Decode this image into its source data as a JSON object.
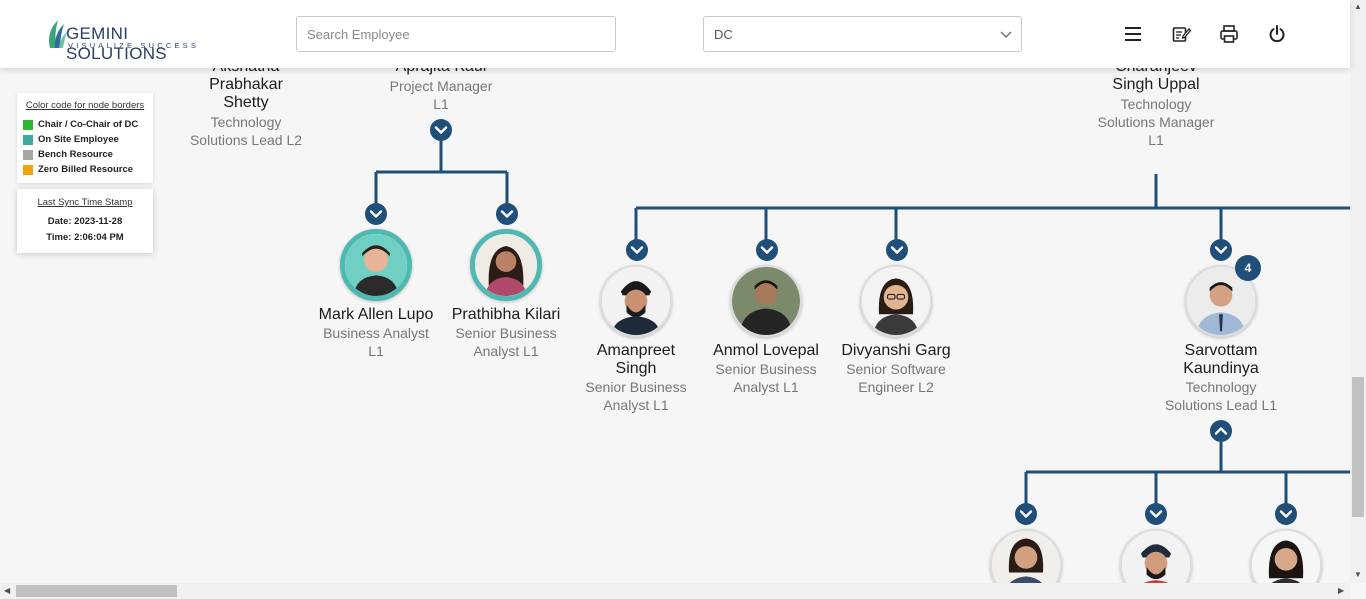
{
  "header": {
    "logo_name": "GEMINI SOLUTIONS",
    "logo_tagline": "VISUALIZE SUCCESS",
    "search_placeholder": "Search Employee",
    "dc_selected": "DC",
    "icons": [
      "menu-icon",
      "notes-icon",
      "print-icon",
      "power-icon"
    ]
  },
  "legend": {
    "title": "Color code for node borders",
    "items": [
      {
        "label": "Chair / Co-Chair of DC",
        "color": "#2db82d"
      },
      {
        "label": "On Site Employee",
        "color": "#3ea9a1"
      },
      {
        "label": "Bench Resource",
        "color": "#a6a6a6"
      },
      {
        "label": "Zero Billed Resource",
        "color": "#f0a30a"
      }
    ]
  },
  "sync": {
    "title": "Last Sync Time Stamp",
    "date": "Date: 2023-11-28",
    "time": "Time: 2:06:04 PM"
  },
  "nodes": {
    "akshatha": {
      "name_lines": [
        "Akshatha",
        "Prabhakar",
        "Shetty"
      ],
      "role_lines": [
        "Technology",
        "Solutions Lead L2"
      ]
    },
    "aprajita": {
      "name_lines": [
        "Aprajita Kaul"
      ],
      "role_lines": [
        "Project Manager",
        "L1"
      ]
    },
    "charanjeev": {
      "name_lines": [
        "Charanjeev",
        "Singh Uppal"
      ],
      "role_lines": [
        "Technology",
        "Solutions Manager",
        "L1"
      ]
    },
    "mark": {
      "name": "Mark Allen Lupo",
      "role_lines": [
        "Business Analyst",
        "L1"
      ]
    },
    "prathibha": {
      "name": "Prathibha Kilari",
      "role_lines": [
        "Senior Business",
        "Analyst L1"
      ]
    },
    "amanpreet": {
      "name_lines": [
        "Amanpreet",
        "Singh"
      ],
      "role_lines": [
        "Senior Business",
        "Analyst L1"
      ]
    },
    "anmol": {
      "name": "Anmol Lovepal",
      "role_lines": [
        "Senior Business",
        "Analyst L1"
      ]
    },
    "divyanshi": {
      "name": "Divyanshi Garg",
      "role_lines": [
        "Senior Software",
        "Engineer L2"
      ]
    },
    "sarvottam": {
      "name_lines": [
        "Sarvottam",
        "Kaundinya"
      ],
      "role_lines": [
        "Technology",
        "Solutions Lead L1"
      ],
      "reportees": "4"
    }
  },
  "colors": {
    "accent": "#1f4e79",
    "onsite_border": "#4fb8b0"
  }
}
